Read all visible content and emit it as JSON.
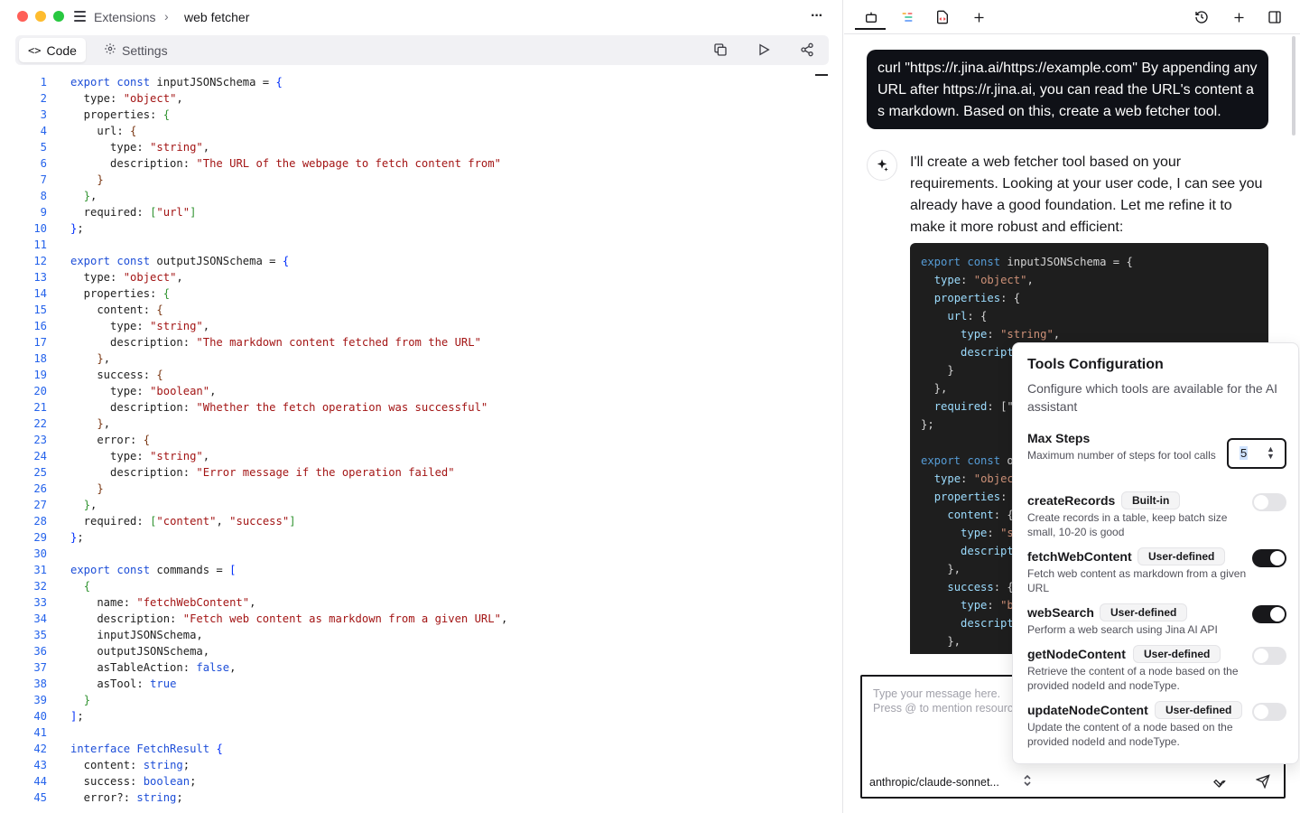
{
  "window": {
    "traffic_lights": [
      "#ff5f57",
      "#febc2e",
      "#28c840"
    ]
  },
  "breadcrumb": {
    "parent": "Extensions",
    "separator": "›",
    "current": "web fetcher"
  },
  "editor_tabs": [
    {
      "label": "Code",
      "icon": "code-icon"
    },
    {
      "label": "Settings",
      "icon": "gear-icon"
    }
  ],
  "editor_code": [
    [
      {
        "t": "export const ",
        "c": "kw"
      },
      {
        "t": "inputJSONSchema = "
      },
      {
        "t": "{",
        "c": "brk1"
      }
    ],
    [
      {
        "t": "  type: "
      },
      {
        "t": "\"object\"",
        "c": "str"
      },
      {
        "t": ","
      }
    ],
    [
      {
        "t": "  properties: "
      },
      {
        "t": "{",
        "c": "brk2"
      }
    ],
    [
      {
        "t": "    url: "
      },
      {
        "t": "{",
        "c": "brk3"
      }
    ],
    [
      {
        "t": "      type: "
      },
      {
        "t": "\"string\"",
        "c": "str"
      },
      {
        "t": ","
      }
    ],
    [
      {
        "t": "      description: "
      },
      {
        "t": "\"The URL of the webpage to fetch content from\"",
        "c": "str"
      }
    ],
    [
      {
        "t": "    "
      },
      {
        "t": "}",
        "c": "brk3"
      }
    ],
    [
      {
        "t": "  "
      },
      {
        "t": "}",
        "c": "brk2"
      },
      {
        "t": ","
      }
    ],
    [
      {
        "t": "  required: "
      },
      {
        "t": "[",
        "c": "brk2"
      },
      {
        "t": "\"url\"",
        "c": "str"
      },
      {
        "t": "]",
        "c": "brk2"
      }
    ],
    [
      {
        "t": "}",
        "c": "brk1"
      },
      {
        "t": ";"
      }
    ],
    [],
    [
      {
        "t": "export const ",
        "c": "kw"
      },
      {
        "t": "outputJSONSchema = "
      },
      {
        "t": "{",
        "c": "brk1"
      }
    ],
    [
      {
        "t": "  type: "
      },
      {
        "t": "\"object\"",
        "c": "str"
      },
      {
        "t": ","
      }
    ],
    [
      {
        "t": "  properties: "
      },
      {
        "t": "{",
        "c": "brk2"
      }
    ],
    [
      {
        "t": "    content: "
      },
      {
        "t": "{",
        "c": "brk3"
      }
    ],
    [
      {
        "t": "      type: "
      },
      {
        "t": "\"string\"",
        "c": "str"
      },
      {
        "t": ","
      }
    ],
    [
      {
        "t": "      description: "
      },
      {
        "t": "\"The markdown content fetched from the URL\"",
        "c": "str"
      }
    ],
    [
      {
        "t": "    "
      },
      {
        "t": "}",
        "c": "brk3"
      },
      {
        "t": ","
      }
    ],
    [
      {
        "t": "    success: "
      },
      {
        "t": "{",
        "c": "brk3"
      }
    ],
    [
      {
        "t": "      type: "
      },
      {
        "t": "\"boolean\"",
        "c": "str"
      },
      {
        "t": ","
      }
    ],
    [
      {
        "t": "      description: "
      },
      {
        "t": "\"Whether the fetch operation was successful\"",
        "c": "str"
      }
    ],
    [
      {
        "t": "    "
      },
      {
        "t": "}",
        "c": "brk3"
      },
      {
        "t": ","
      }
    ],
    [
      {
        "t": "    error: "
      },
      {
        "t": "{",
        "c": "brk3"
      }
    ],
    [
      {
        "t": "      type: "
      },
      {
        "t": "\"string\"",
        "c": "str"
      },
      {
        "t": ","
      }
    ],
    [
      {
        "t": "      description: "
      },
      {
        "t": "\"Error message if the operation failed\"",
        "c": "str"
      }
    ],
    [
      {
        "t": "    "
      },
      {
        "t": "}",
        "c": "brk3"
      }
    ],
    [
      {
        "t": "  "
      },
      {
        "t": "}",
        "c": "brk2"
      },
      {
        "t": ","
      }
    ],
    [
      {
        "t": "  required: "
      },
      {
        "t": "[",
        "c": "brk2"
      },
      {
        "t": "\"content\"",
        "c": "str"
      },
      {
        "t": ", "
      },
      {
        "t": "\"success\"",
        "c": "str"
      },
      {
        "t": "]",
        "c": "brk2"
      }
    ],
    [
      {
        "t": "}",
        "c": "brk1"
      },
      {
        "t": ";"
      }
    ],
    [],
    [
      {
        "t": "export const ",
        "c": "kw"
      },
      {
        "t": "commands = "
      },
      {
        "t": "[",
        "c": "brk1"
      }
    ],
    [
      {
        "t": "  "
      },
      {
        "t": "{",
        "c": "brk2"
      }
    ],
    [
      {
        "t": "    name: "
      },
      {
        "t": "\"fetchWebContent\"",
        "c": "str"
      },
      {
        "t": ","
      }
    ],
    [
      {
        "t": "    description: "
      },
      {
        "t": "\"Fetch web content as markdown from a given URL\"",
        "c": "str"
      },
      {
        "t": ","
      }
    ],
    [
      {
        "t": "    inputJSONSchema,"
      }
    ],
    [
      {
        "t": "    outputJSONSchema,"
      }
    ],
    [
      {
        "t": "    asTableAction: "
      },
      {
        "t": "false",
        "c": "kw"
      },
      {
        "t": ","
      }
    ],
    [
      {
        "t": "    asTool: "
      },
      {
        "t": "true",
        "c": "kw"
      }
    ],
    [
      {
        "t": "  "
      },
      {
        "t": "}",
        "c": "brk2"
      }
    ],
    [
      {
        "t": "]",
        "c": "brk1"
      },
      {
        "t": ";"
      }
    ],
    [],
    [
      {
        "t": "interface ",
        "c": "kw"
      },
      {
        "t": "FetchResult ",
        "c": "typ"
      },
      {
        "t": "{",
        "c": "brk1"
      }
    ],
    [
      {
        "t": "  content: "
      },
      {
        "t": "string",
        "c": "kw"
      },
      {
        "t": ";"
      }
    ],
    [
      {
        "t": "  success: "
      },
      {
        "t": "boolean",
        "c": "kw"
      },
      {
        "t": ";"
      }
    ],
    [
      {
        "t": "  error?: "
      },
      {
        "t": "string",
        "c": "kw"
      },
      {
        "t": ";"
      }
    ]
  ],
  "chat": {
    "user_message": "curl \"https://r.jina.ai/https://example.com\" By appending any URL after https://r.jina.ai, you can read the URL's content as markdown. Based on this, create a web fetcher tool.",
    "ai_message": "I'll create a web fetcher tool based on your requirements. Looking at your user code, I can see you already have a good foundation. Let me refine it to make it more robust and efficient:",
    "ai_code": [
      [
        {
          "t": "export const ",
          "c": "ac-kw"
        },
        {
          "t": "inputJSONSchema = {"
        }
      ],
      [
        {
          "t": "  "
        },
        {
          "t": "type",
          "c": "ac-key"
        },
        {
          "t": ": "
        },
        {
          "t": "\"object\"",
          "c": "ac-str"
        },
        {
          "t": ","
        }
      ],
      [
        {
          "t": "  "
        },
        {
          "t": "properties",
          "c": "ac-key"
        },
        {
          "t": ": {"
        }
      ],
      [
        {
          "t": "    "
        },
        {
          "t": "url",
          "c": "ac-key"
        },
        {
          "t": ": {"
        }
      ],
      [
        {
          "t": "      "
        },
        {
          "t": "type",
          "c": "ac-key"
        },
        {
          "t": ": "
        },
        {
          "t": "\"string\"",
          "c": "ac-str"
        },
        {
          "t": ","
        }
      ],
      [
        {
          "t": "      "
        },
        {
          "t": "descript",
          "c": "ac-key"
        }
      ],
      [
        {
          "t": "    }"
        }
      ],
      [
        {
          "t": "  },"
        }
      ],
      [
        {
          "t": "  "
        },
        {
          "t": "required",
          "c": "ac-key"
        },
        {
          "t": ": [\""
        }
      ],
      [
        {
          "t": "};"
        }
      ],
      [],
      [
        {
          "t": "export const ",
          "c": "ac-kw"
        },
        {
          "t": "o"
        }
      ],
      [
        {
          "t": "  "
        },
        {
          "t": "type",
          "c": "ac-key"
        },
        {
          "t": ": "
        },
        {
          "t": "\"objec",
          "c": "ac-str"
        }
      ],
      [
        {
          "t": "  "
        },
        {
          "t": "properties",
          "c": "ac-key"
        },
        {
          "t": ":"
        }
      ],
      [
        {
          "t": "    "
        },
        {
          "t": "content",
          "c": "ac-key"
        },
        {
          "t": ": {"
        }
      ],
      [
        {
          "t": "      "
        },
        {
          "t": "type",
          "c": "ac-key"
        },
        {
          "t": ": "
        },
        {
          "t": "\"s",
          "c": "ac-str"
        }
      ],
      [
        {
          "t": "      "
        },
        {
          "t": "descript",
          "c": "ac-key"
        }
      ],
      [
        {
          "t": "    },"
        }
      ],
      [
        {
          "t": "    "
        },
        {
          "t": "success",
          "c": "ac-key"
        },
        {
          "t": ": {"
        }
      ],
      [
        {
          "t": "      "
        },
        {
          "t": "type",
          "c": "ac-key"
        },
        {
          "t": ": "
        },
        {
          "t": "\"b",
          "c": "ac-str"
        }
      ],
      [
        {
          "t": "      "
        },
        {
          "t": "descript",
          "c": "ac-key"
        }
      ],
      [
        {
          "t": "    },"
        }
      ]
    ],
    "composer_placeholder_line1": "Type your message here.",
    "composer_placeholder_line2": "Press @ to mention resourc",
    "model_name": "anthropic/claude-sonnet..."
  },
  "tools_config": {
    "title": "Tools Configuration",
    "description": "Configure which tools are available for the AI assistant",
    "max_steps_label": "Max Steps",
    "max_steps_desc": "Maximum number of steps for tool calls",
    "max_steps_value": "5",
    "tools": [
      {
        "name": "createRecords",
        "badge": "Built-in",
        "desc": "Create records in a table, keep batch size small, 10-20 is good",
        "enabled": false
      },
      {
        "name": "fetchWebContent",
        "badge": "User-defined",
        "desc": "Fetch web content as markdown from a given URL",
        "enabled": true
      },
      {
        "name": "webSearch",
        "badge": "User-defined",
        "desc": "Perform a web search using Jina AI API",
        "enabled": true
      },
      {
        "name": "getNodeContent",
        "badge": "User-defined",
        "desc": "Retrieve the content of a node based on the provided nodeId and nodeType.",
        "enabled": false
      },
      {
        "name": "updateNodeContent",
        "badge": "User-defined",
        "desc": "Update the content of a node based on the provided nodeId and nodeType.",
        "enabled": false
      }
    ]
  }
}
